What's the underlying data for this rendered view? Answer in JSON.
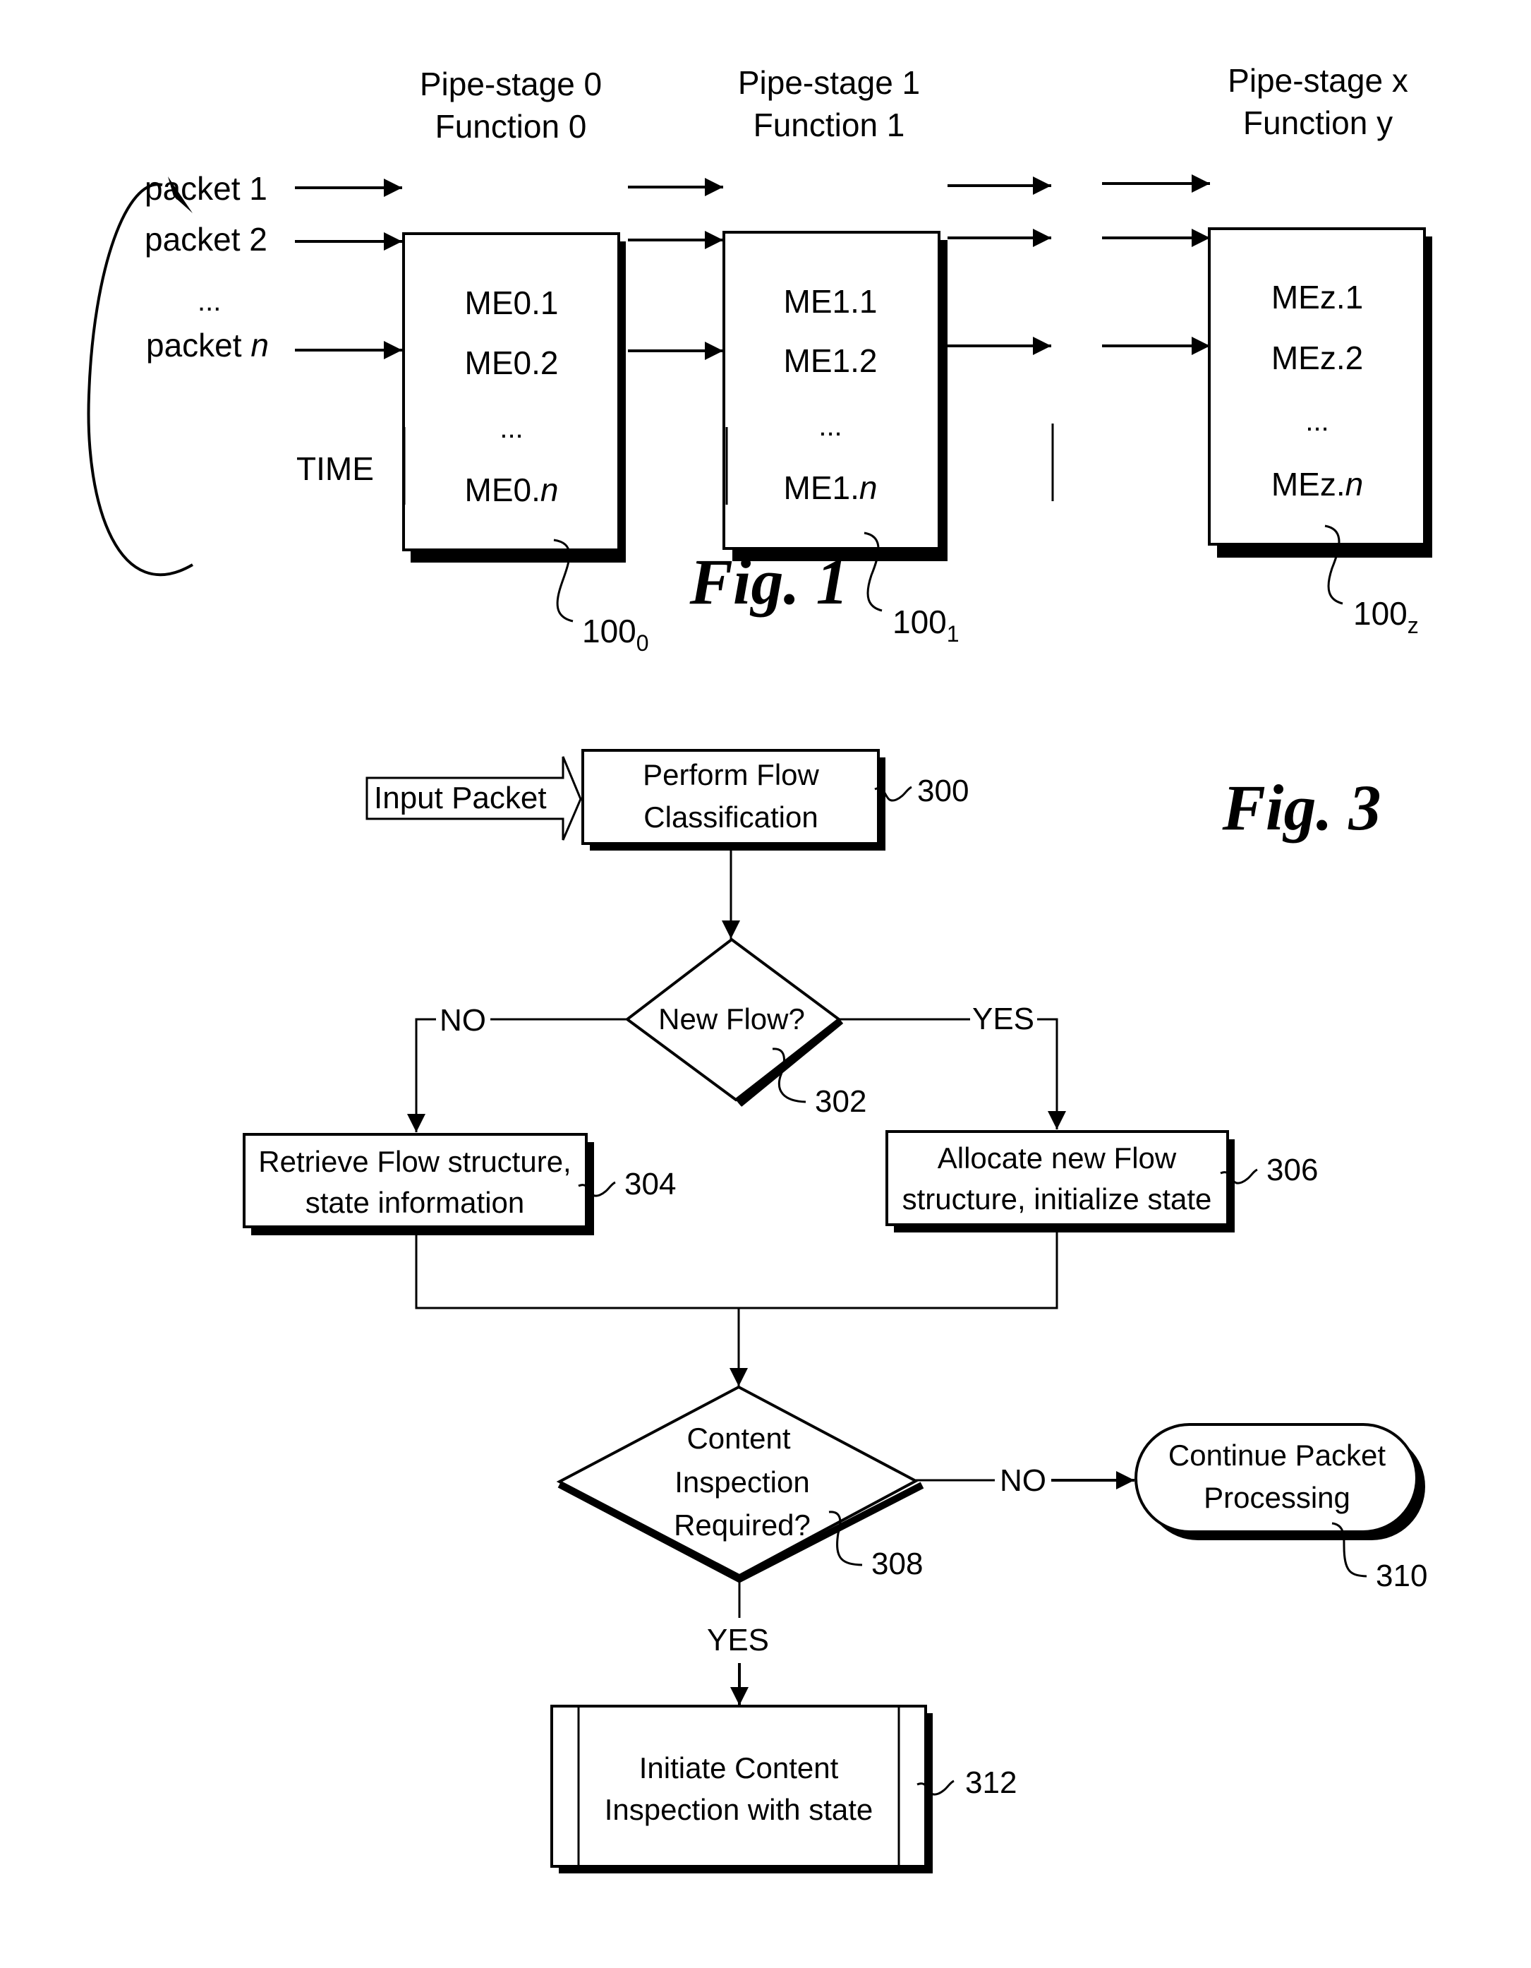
{
  "fig1": {
    "caption": "Fig. 1",
    "packets": [
      "packet 1",
      "packet 2",
      "...",
      "packet n"
    ],
    "packet_prefix": "packet ",
    "packet_var": "n",
    "time_label": "TIME",
    "stages": [
      {
        "title1": "Pipe-stage 0",
        "title2": "Function 0",
        "items": [
          "ME0.1",
          "ME0.2",
          "...",
          "ME0."
        ],
        "item_var": "n",
        "ref": "100",
        "ref_sub": "0"
      },
      {
        "title1": "Pipe-stage 1",
        "title2": "Function 1",
        "items": [
          "ME1.1",
          "ME1.2",
          "...",
          "ME1."
        ],
        "item_var": "n",
        "ref": "100",
        "ref_sub": "1"
      },
      {
        "title1": "Pipe-stage x",
        "title2": "Function y",
        "items": [
          "MEz.1",
          "MEz.2",
          "...",
          "MEz."
        ],
        "item_var": "n",
        "ref": "100",
        "ref_sub": "z"
      }
    ]
  },
  "fig3": {
    "caption": "Fig. 3",
    "input_label": "Input Packet",
    "nodes": {
      "n300": {
        "lines": [
          "Perform Flow",
          "Classification"
        ],
        "ref": "300"
      },
      "n302": {
        "lines": [
          "New Flow?"
        ],
        "ref": "302"
      },
      "n304": {
        "lines": [
          "Retrieve Flow structure,",
          "state information"
        ],
        "ref": "304"
      },
      "n306": {
        "lines": [
          "Allocate new Flow",
          "structure, initialize state"
        ],
        "ref": "306"
      },
      "n308": {
        "lines": [
          "Content",
          "Inspection",
          "Required?"
        ],
        "ref": "308"
      },
      "n310": {
        "lines": [
          "Continue Packet",
          "Processing"
        ],
        "ref": "310"
      },
      "n312": {
        "lines": [
          "Initiate Content",
          "Inspection with state"
        ],
        "ref": "312"
      }
    },
    "edge_labels": {
      "no1": "NO",
      "yes1": "YES",
      "no2": "NO",
      "yes2": "YES"
    }
  }
}
